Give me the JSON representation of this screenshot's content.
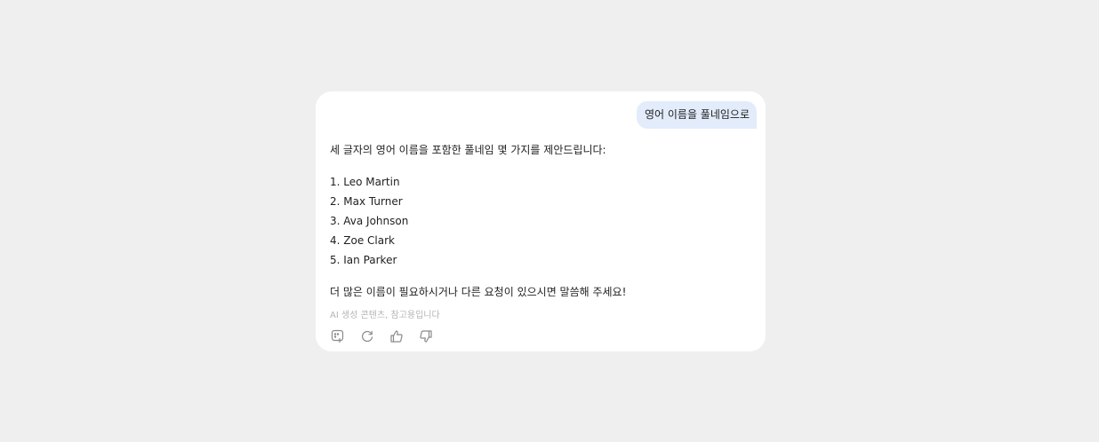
{
  "user_message": "영어 이름을 풀네임으로",
  "assistant": {
    "intro": "세 글자의 영어 이름을 포함한 풀네임 몇 가지를 제안드립니다:",
    "names": [
      "1. Leo Martin",
      "2. Max Turner",
      "3. Ava Johnson",
      "4. Zoe Clark",
      "5. Ian Parker"
    ],
    "outro": "더 많은 이름이 필요하시거나 다른 요청이 있으시면 말씀해 주세요!",
    "disclaimer": "AI 생성 콘텐츠, 참고용입니다"
  },
  "actions": [
    {
      "icon": "copy-icon"
    },
    {
      "icon": "refresh-icon"
    },
    {
      "icon": "thumbs-up-icon"
    },
    {
      "icon": "thumbs-down-icon"
    }
  ],
  "colors": {
    "background": "#efefef",
    "card": "#ffffff",
    "user_bubble": "#e3ecfb",
    "text": "#1f1f1f",
    "muted": "#b4b4b4",
    "icon": "#8a8a8a"
  }
}
